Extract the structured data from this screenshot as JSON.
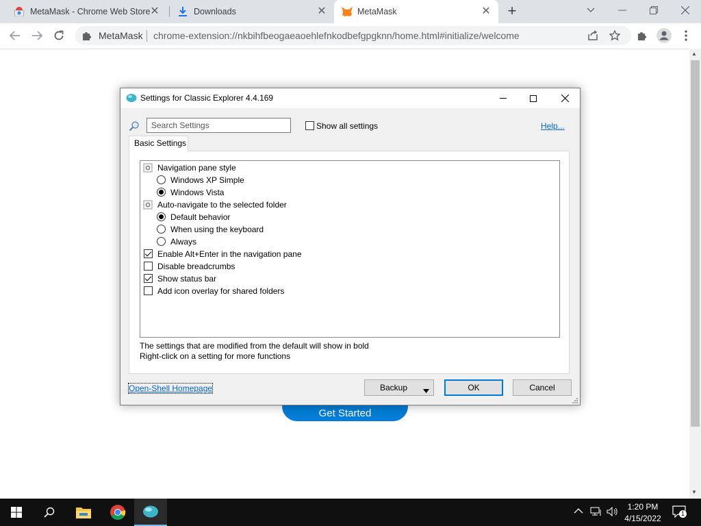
{
  "browser": {
    "tabs": [
      {
        "title": "MetaMask - Chrome Web Store",
        "icon": "chrome-web-store-icon"
      },
      {
        "title": "Downloads",
        "icon": "download-icon"
      },
      {
        "title": "MetaMask",
        "icon": "metamask-fox-icon",
        "active": true
      }
    ],
    "new_tab_label": "+",
    "omnibox": {
      "site_name": "MetaMask",
      "url": "chrome-extension://nkbihfbeogaeaoehlefnkodbefgpgknn/home.html#initialize/welcome"
    }
  },
  "page": {
    "get_started_label": "Get Started",
    "accent_color": "#037dd6"
  },
  "dialog": {
    "title": "Settings for Classic Explorer 4.4.169",
    "search_placeholder": "Search Settings",
    "show_all_label": "Show all settings",
    "show_all_checked": false,
    "help_label": "Help...",
    "tab_label": "Basic Settings",
    "settings": [
      {
        "type": "group",
        "label": "Navigation pane style"
      },
      {
        "type": "radio",
        "label": "Windows XP Simple",
        "checked": false
      },
      {
        "type": "radio",
        "label": "Windows Vista",
        "checked": true
      },
      {
        "type": "group",
        "label": "Auto-navigate to the selected folder"
      },
      {
        "type": "radio",
        "label": "Default behavior",
        "checked": true
      },
      {
        "type": "radio",
        "label": "When using the keyboard",
        "checked": false
      },
      {
        "type": "radio",
        "label": "Always",
        "checked": false
      },
      {
        "type": "checkbox",
        "label": "Enable Alt+Enter in the navigation pane",
        "checked": true
      },
      {
        "type": "checkbox",
        "label": "Disable breadcrumbs",
        "checked": false
      },
      {
        "type": "checkbox",
        "label": "Show status bar",
        "checked": true
      },
      {
        "type": "checkbox",
        "label": "Add icon overlay for shared folders",
        "checked": false
      }
    ],
    "hint_line1": "The settings that are modified from the default will show in bold",
    "hint_line2": "Right-click on a setting for more functions",
    "homepage_link": "Open-Shell Homepage",
    "backup_label": "Backup",
    "ok_label": "OK",
    "cancel_label": "Cancel"
  },
  "taskbar": {
    "time": "1:20 PM",
    "date": "4/15/2022",
    "notification_count": "1"
  }
}
